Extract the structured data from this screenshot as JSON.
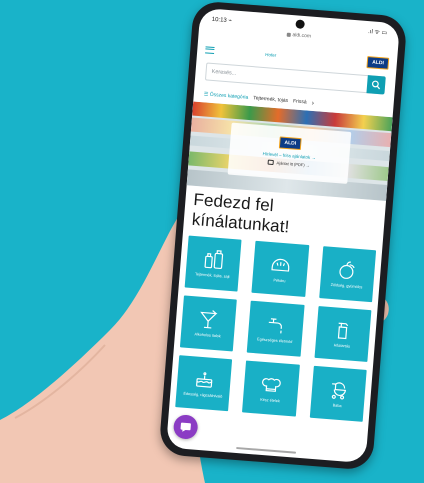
{
  "colors": {
    "background": "#19b3c9",
    "brand_teal": "#0f9fb3",
    "tile": "#19b0c6",
    "aldi_blue": "#0d3c86",
    "aldi_orange": "#f2a31b",
    "chat": "#8b3cc4"
  },
  "status": {
    "time": "10:13 ⌁",
    "icons": ".ıl ᯤ ▭"
  },
  "browser": {
    "url": "aldi.com"
  },
  "header": {
    "brand_small": "Hofer",
    "aldi_badge": "ALDI"
  },
  "search": {
    "placeholder": "Keresés..."
  },
  "categories": {
    "items": [
      "☰ Összes kategória",
      "Tejtermék, tojás",
      "Frissá"
    ],
    "more_icon": "chevron-right-icon"
  },
  "hero": {
    "aldi_badge": "ALDI",
    "link": "Hírlevél – friss ajánlatok →",
    "line": "Ajánlat itt (PDF) →"
  },
  "headline": {
    "line1": "Fedezd fel",
    "line2": "kínálatunkat!"
  },
  "tiles": [
    {
      "icon": "bottles-icon",
      "label": "Tejtermék, tojás, sajt"
    },
    {
      "icon": "bread-icon",
      "label": "Pékáru"
    },
    {
      "icon": "fruit-icon",
      "label": "Zöldség, gyümölcs"
    },
    {
      "icon": "cocktail-icon",
      "label": "Alkoholos italok"
    },
    {
      "icon": "faucet-icon",
      "label": "Egészséges életmód"
    },
    {
      "icon": "spray-bottle-icon",
      "label": "Háztartás"
    },
    {
      "icon": "cake-icon",
      "label": "Édesség, rágcsálnivaló"
    },
    {
      "icon": "chef-hat-icon",
      "label": "Kész ételek"
    },
    {
      "icon": "stroller-icon",
      "label": "Baba"
    }
  ]
}
